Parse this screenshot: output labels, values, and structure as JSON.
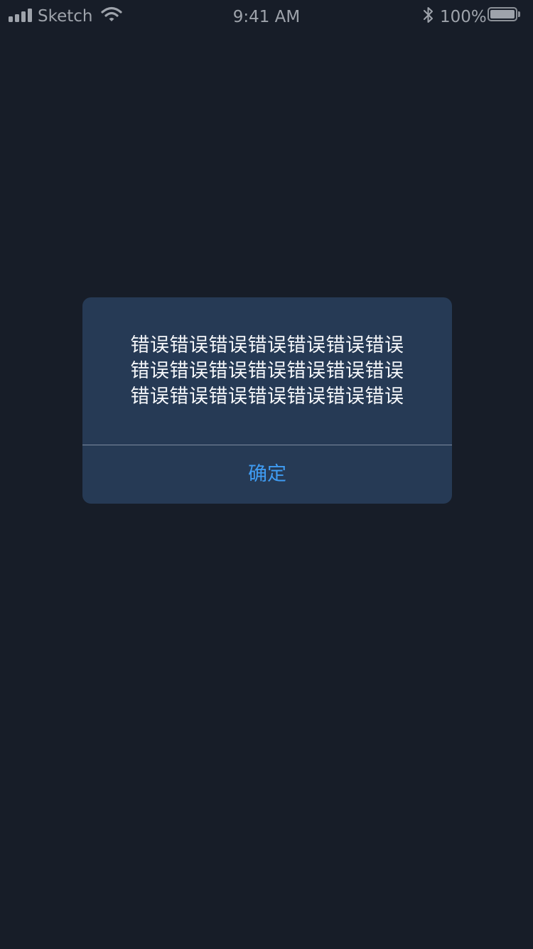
{
  "status_bar": {
    "carrier": "Sketch",
    "time": "9:41 AM",
    "battery_percent": "100%",
    "battery_level": 1.0,
    "icons": [
      "signal-icon",
      "wifi-icon",
      "bluetooth-icon",
      "battery-icon"
    ]
  },
  "alert": {
    "message_lines": [
      "错误错误错误错误错误错误错误",
      "错误错误错误错误错误错误错误",
      "错误错误错误错误错误错误错误"
    ],
    "confirm_label": "确定"
  },
  "colors": {
    "background": "#171d28",
    "alert_background": "#263a55",
    "accent": "#3f9cf3",
    "status_text": "#9ea3ab"
  }
}
